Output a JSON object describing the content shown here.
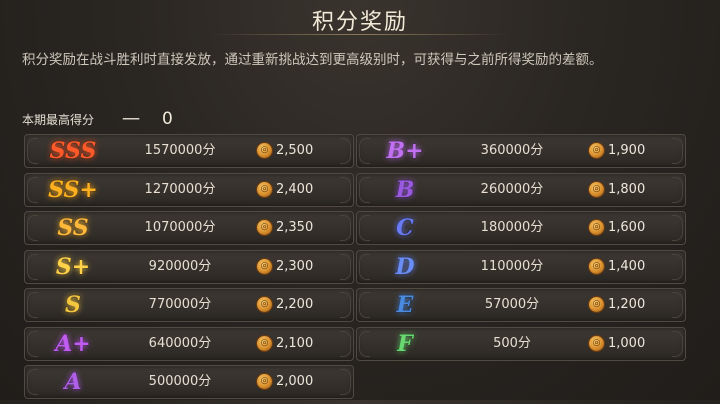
{
  "title": "积分奖励",
  "description": "积分奖励在战斗胜利时直接发放，通过重新挑战达到更高级别时，可获得与之前所得奖励的差额。",
  "best_score": {
    "label": "本期最高得分",
    "dash": "一",
    "value": "0"
  },
  "colors": {
    "SSS": "#ff5a2a",
    "SS+": "#ffb020",
    "SS": "#ffb83a",
    "S+": "#ffd24a",
    "S": "#f5c640",
    "A+": "#c05cf0",
    "A": "#b060e8",
    "B+": "#c070f0",
    "B": "#9a5ae0",
    "C": "#6a7cf5",
    "D": "#6a8cf5",
    "E": "#4a8ae0",
    "F": "#6ad870"
  },
  "left_rows": [
    {
      "grade": "SSS",
      "score": "1570000分",
      "icon": "coin-icon",
      "reward": "2,500"
    },
    {
      "grade": "SS+",
      "score": "1270000分",
      "icon": "coin-icon",
      "reward": "2,400"
    },
    {
      "grade": "SS",
      "score": "1070000分",
      "icon": "coin-icon",
      "reward": "2,350"
    },
    {
      "grade": "S+",
      "score": "920000分",
      "icon": "coin-icon",
      "reward": "2,300"
    },
    {
      "grade": "S",
      "score": "770000分",
      "icon": "coin-icon",
      "reward": "2,200"
    },
    {
      "grade": "A+",
      "score": "640000分",
      "icon": "coin-icon",
      "reward": "2,100"
    },
    {
      "grade": "A",
      "score": "500000分",
      "icon": "coin-icon",
      "reward": "2,000"
    }
  ],
  "right_rows": [
    {
      "grade": "B+",
      "score": "360000分",
      "icon": "coin-icon",
      "reward": "1,900"
    },
    {
      "grade": "B",
      "score": "260000分",
      "icon": "coin-icon",
      "reward": "1,800"
    },
    {
      "grade": "C",
      "score": "180000分",
      "icon": "coin-icon",
      "reward": "1,600"
    },
    {
      "grade": "D",
      "score": "110000分",
      "icon": "coin-icon",
      "reward": "1,400"
    },
    {
      "grade": "E",
      "score": "57000分",
      "icon": "coin-icon",
      "reward": "1,200"
    },
    {
      "grade": "F",
      "score": "500分",
      "icon": "coin-icon",
      "reward": "1,000"
    }
  ]
}
